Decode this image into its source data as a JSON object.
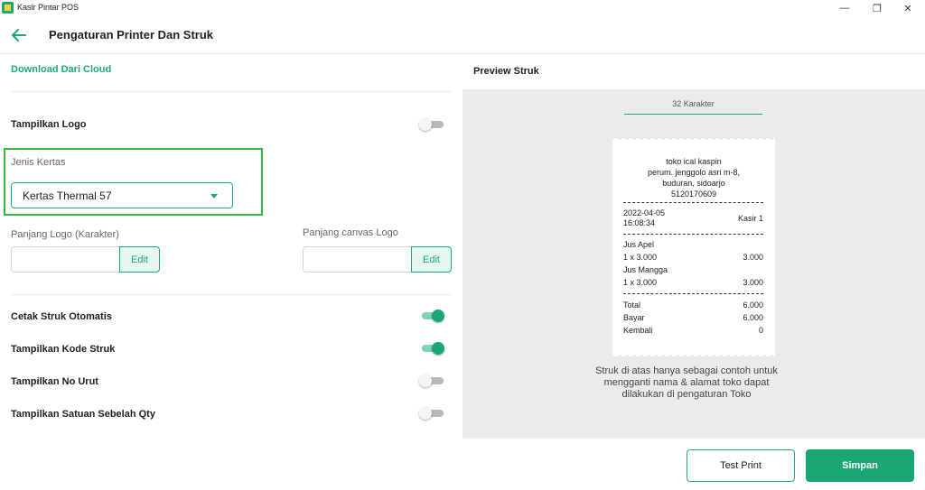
{
  "window": {
    "title": "Kasir Pintar POS",
    "icon": "kasir-pintar-app-icon",
    "controls": {
      "minimize": "—",
      "maximize": "❐",
      "close": "✕"
    }
  },
  "header": {
    "back_icon": "arrow-left-icon",
    "title": "Pengaturan Printer Dan Struk"
  },
  "settings": {
    "download_link": "Download Dari Cloud",
    "show_logo": {
      "label": "Tampilkan Logo",
      "enabled": false
    },
    "paper_type": {
      "label": "Jenis Kertas",
      "selected": "Kertas Thermal 57"
    },
    "logo_length": {
      "label": "Panjang Logo (Karakter)",
      "value": "",
      "edit_label": "Edit"
    },
    "logo_canvas_length": {
      "label": "Panjang canvas Logo",
      "value": "",
      "edit_label": "Edit"
    },
    "auto_print": {
      "label": "Cetak Struk Otomatis",
      "enabled": true
    },
    "show_receipt_code": {
      "label": "Tampilkan Kode Struk",
      "enabled": true
    },
    "show_order_number": {
      "label": "Tampilkan No Urut",
      "enabled": false
    },
    "show_unit_beside_qty": {
      "label": "Tampilkan Satuan Sebelah Qty",
      "enabled": false
    }
  },
  "preview": {
    "title": "Preview Struk",
    "char_tab": "32 Karakter",
    "receipt": {
      "store_name": "toko ical kaspin",
      "address_line1": "perum. jenggolo asri m-8,",
      "address_line2": "buduran, sidoarjo",
      "phone": "5120170609",
      "date": "2022-04-05",
      "time": "16:08:34",
      "cashier": "Kasir 1",
      "items": [
        {
          "name": "Jus Apel",
          "qty_price": "1 x 3.000",
          "total": "3.000"
        },
        {
          "name": "Jus Mangga",
          "qty_price": "1 x 3.000",
          "total": "3.000"
        }
      ],
      "summary": [
        {
          "label": "Total",
          "value": "6.000"
        },
        {
          "label": "Bayar",
          "value": "6.000"
        },
        {
          "label": "Kembali",
          "value": "0"
        }
      ]
    },
    "note_line1": "Struk di atas hanya sebagai contoh untuk",
    "note_line2": "mengganti nama & alamat toko dapat",
    "note_line3": "dilakukan di pengaturan Toko"
  },
  "actions": {
    "test_print": "Test Print",
    "save": "Simpan"
  },
  "colors": {
    "accent": "#1aa774",
    "highlight": "#2ebb45"
  }
}
